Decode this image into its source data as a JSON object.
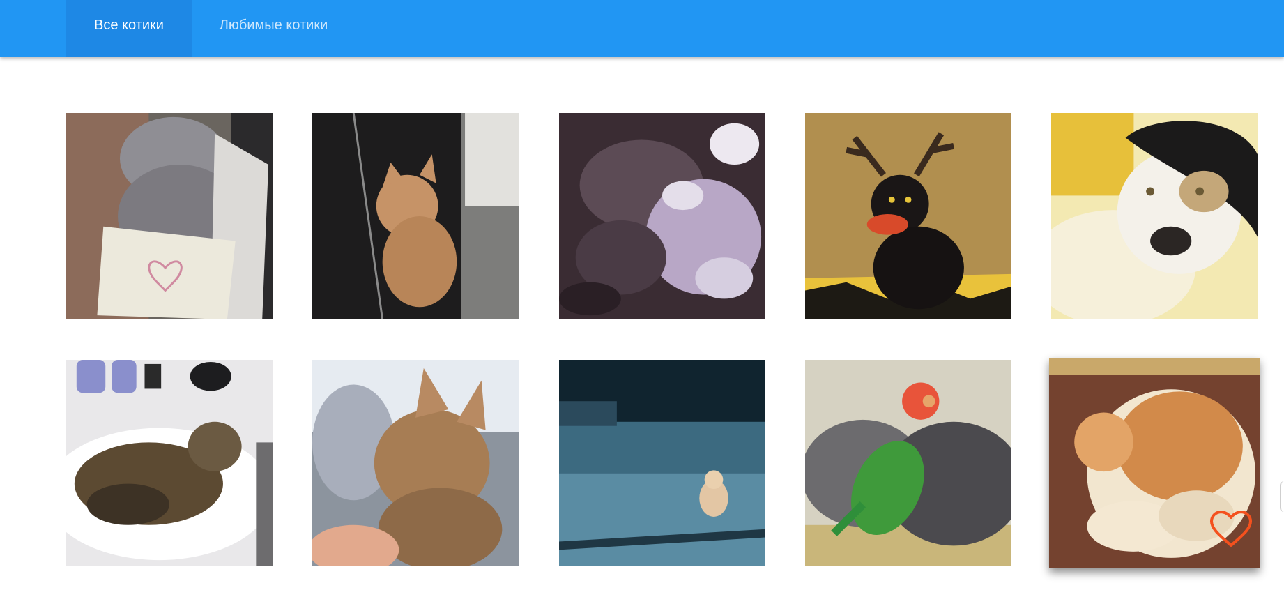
{
  "nav": {
    "tabs": [
      {
        "label": "Все котики",
        "active": true
      },
      {
        "label": "Любимые котики",
        "active": false
      }
    ]
  },
  "cats": [
    {
      "name": "grey-cat-with-heart-note",
      "favorite": false
    },
    {
      "name": "ginger-kitten-in-jacket",
      "favorite": false
    },
    {
      "name": "cat-in-dappled-shade",
      "favorite": false
    },
    {
      "name": "black-cat-with-antlers",
      "favorite": false
    },
    {
      "name": "black-white-cat-under-hat",
      "favorite": false
    },
    {
      "name": "tabby-cat-in-sink",
      "favorite": false
    },
    {
      "name": "tabby-kitten-closeup",
      "favorite": false
    },
    {
      "name": "kitten-on-blue-floor",
      "favorite": false
    },
    {
      "name": "cat-with-parrot",
      "favorite": false
    },
    {
      "name": "curled-ginger-cat",
      "favorite": false,
      "hovered": true
    }
  ],
  "colors": {
    "navbar": "#2196f3",
    "active_tab": "#1e88e5",
    "heart": "#f4511e"
  }
}
